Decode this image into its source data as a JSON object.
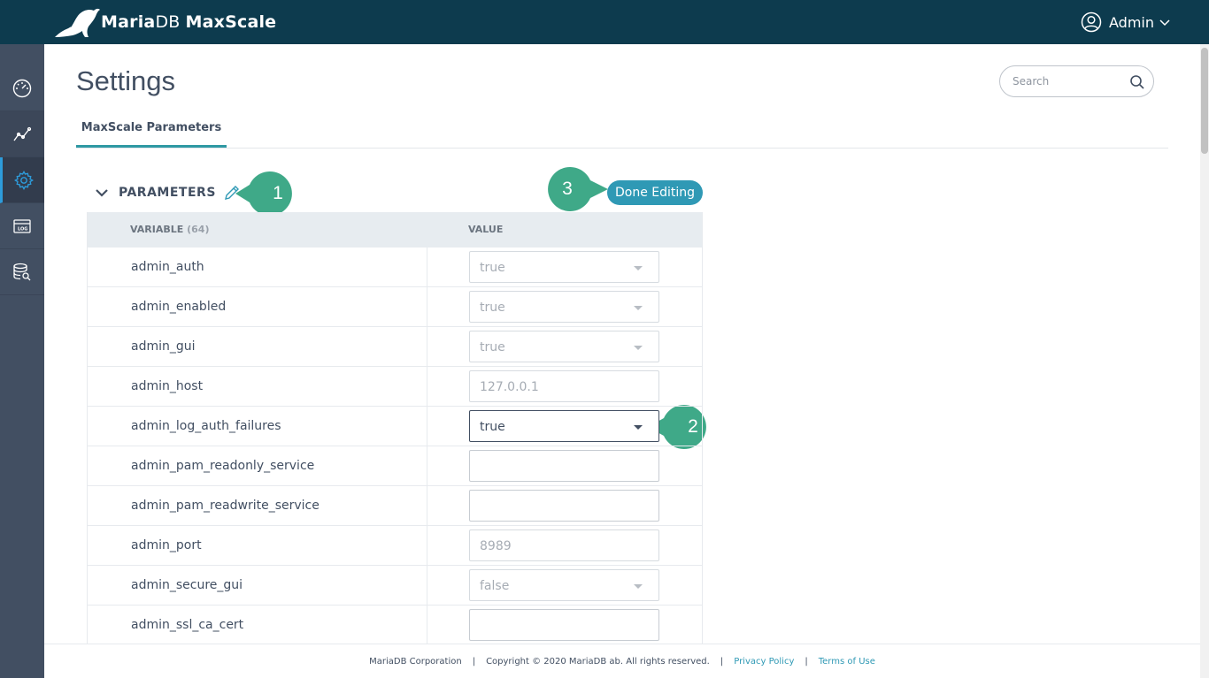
{
  "app": {
    "brand_main": "Maria",
    "brand_db": "DB",
    "brand_product": "MaxScale",
    "user_name": "Admin"
  },
  "page": {
    "title": "Settings",
    "search_placeholder": "Search",
    "tab_label": "MaxScale Parameters"
  },
  "section": {
    "title": "PARAMETERS",
    "done_label": "Done Editing"
  },
  "callouts": {
    "one": "1",
    "two": "2",
    "three": "3",
    "color": "#3fa988"
  },
  "table": {
    "col_variable": "VARIABLE",
    "col_count": "(64)",
    "col_value": "VALUE",
    "rows": [
      {
        "variable": "admin_auth",
        "value": "true"
      },
      {
        "variable": "admin_enabled",
        "value": "true"
      },
      {
        "variable": "admin_gui",
        "value": "true"
      },
      {
        "variable": "admin_host",
        "value": "127.0.0.1"
      },
      {
        "variable": "admin_log_auth_failures",
        "value": "true"
      },
      {
        "variable": "admin_pam_readonly_service",
        "value": ""
      },
      {
        "variable": "admin_pam_readwrite_service",
        "value": ""
      },
      {
        "variable": "admin_port",
        "value": "8989"
      },
      {
        "variable": "admin_secure_gui",
        "value": "false"
      },
      {
        "variable": "admin_ssl_ca_cert",
        "value": ""
      }
    ]
  },
  "footer": {
    "company": "MariaDB Corporation",
    "copyright": "Copyright © 2020 MariaDB ab. All rights reserved.",
    "privacy": "Privacy Policy",
    "terms": "Terms of Use"
  },
  "colors": {
    "topbar": "#0d3b4e",
    "sidebar": "#424f62",
    "accent": "#2f99b5",
    "tab_underline": "#2f99a3"
  }
}
